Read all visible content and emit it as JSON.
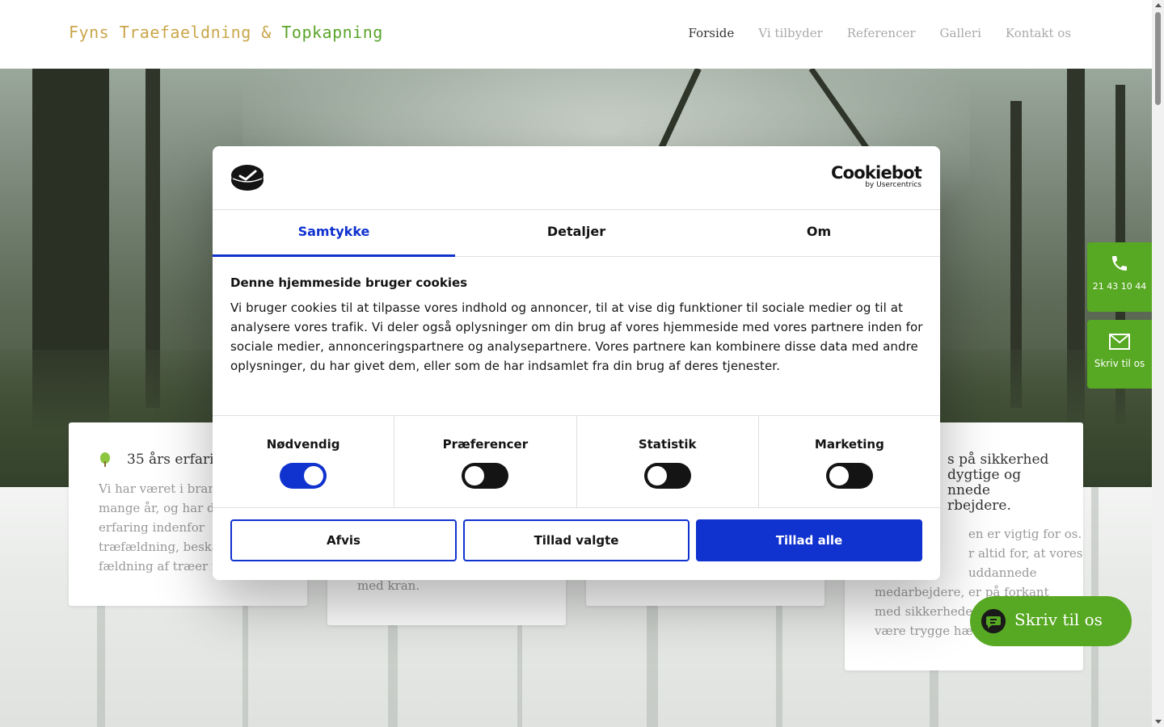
{
  "header": {
    "logo": {
      "part1": "Fyns Traefaeldning",
      "amp": "&",
      "part2": "Topkapning"
    },
    "nav": [
      "Forside",
      "Vi tilbyder",
      "Referencer",
      "Galleri",
      "Kontakt os"
    ],
    "active_nav": "Forside"
  },
  "cards": [
    {
      "title": "35 års erfarin",
      "body": [
        "Vi har været i brand",
        "mange år, og har d",
        "erfaring indenfor",
        "træfældning, beska",
        "fældning af træer r"
      ]
    },
    {
      "body": [
        "med kran."
      ]
    },
    {
      "title": [
        "s på sikkerhed",
        "dygtige og",
        "nnede",
        "rbejdere."
      ],
      "body": [
        "en er vigtig for os.",
        "r altid for, at vores",
        "uddannede",
        "medarbejdere, er på forkant",
        "med sikkerhede",
        "være trygge hæ"
      ]
    }
  ],
  "cookie_dialog": {
    "brand_main": "Cookiebot",
    "brand_sub": "by Usercentrics",
    "tabs": [
      "Samtykke",
      "Detaljer",
      "Om"
    ],
    "active_tab": "Samtykke",
    "heading": "Denne hjemmeside bruger cookies",
    "text": "Vi bruger cookies til at tilpasse vores indhold og annoncer, til at vise dig funktioner til sociale medier og til at analysere vores trafik. Vi deler også oplysninger om din brug af vores hjemmeside med vores partnere inden for sociale medier, annonceringspartnere og analysepartnere. Vores partnere kan kombinere disse data med andre oplysninger, du har givet dem, eller som de har indsamlet fra din brug af deres tjenester.",
    "toggles": [
      {
        "label": "Nødvendig",
        "on": true
      },
      {
        "label": "Præferencer",
        "on": false
      },
      {
        "label": "Statistik",
        "on": false
      },
      {
        "label": "Marketing",
        "on": false
      }
    ],
    "buttons": {
      "reject": "Afvis",
      "allow_selected": "Tillad valgte",
      "allow_all": "Tillad alle"
    }
  },
  "contact": {
    "phone": "21 43 10 44",
    "write": "Skriv til os",
    "chat": "Skriv til os"
  },
  "colors": {
    "accent_blue": "#1032cf",
    "brand_green": "#57a822"
  },
  "icons": [
    "leaf-icon",
    "phone-icon",
    "envelope-icon",
    "chat-icon",
    "cookiebot-logo-icon"
  ]
}
